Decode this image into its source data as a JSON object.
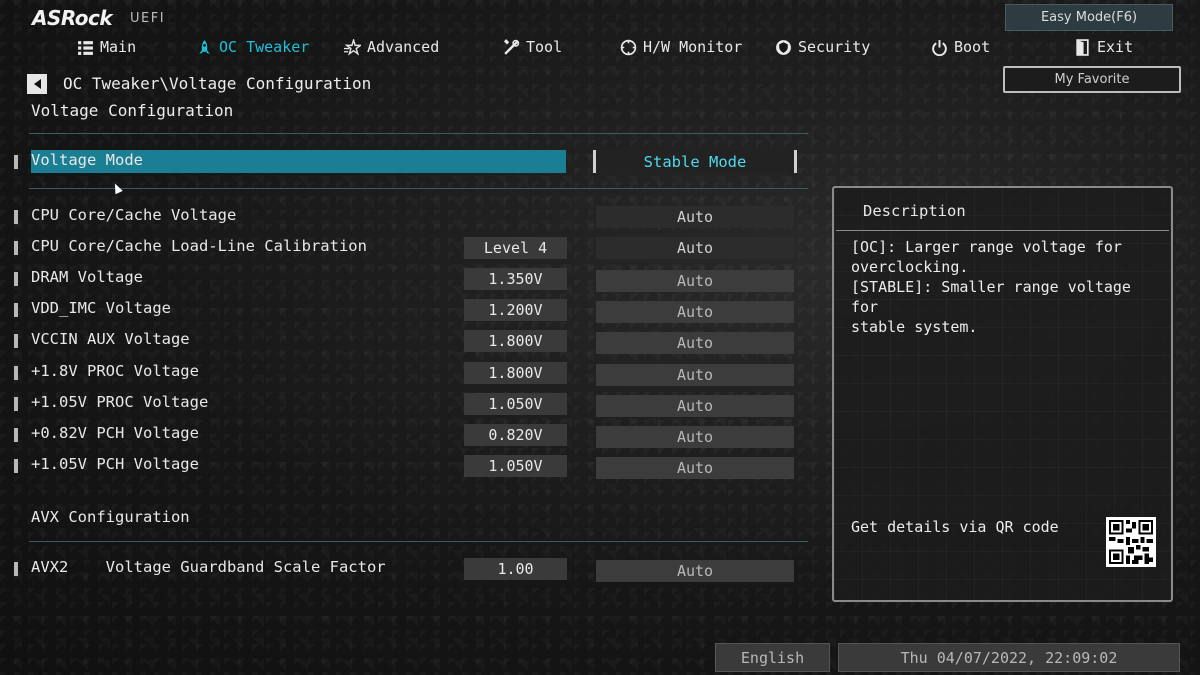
{
  "brand": {
    "logo": "ASRock",
    "sub": "UEFI"
  },
  "header": {
    "easy_mode": "Easy Mode(F6)",
    "my_favorite": "My Favorite"
  },
  "nav": [
    {
      "label": "Main",
      "icon": "main-list-icon",
      "active": false
    },
    {
      "label": "OC Tweaker",
      "icon": "rocket-icon",
      "active": true
    },
    {
      "label": "Advanced",
      "icon": "advanced-star-icon",
      "active": false
    },
    {
      "label": "Tool",
      "icon": "tools-icon",
      "active": false
    },
    {
      "label": "H/W Monitor",
      "icon": "monitor-gauge-icon",
      "active": false
    },
    {
      "label": "Security",
      "icon": "shield-icon",
      "active": false
    },
    {
      "label": "Boot",
      "icon": "power-icon",
      "active": false
    },
    {
      "label": "Exit",
      "icon": "exit-door-icon",
      "active": false
    }
  ],
  "breadcrumb": "OC Tweaker\\Voltage Configuration",
  "section_title": "Voltage Configuration",
  "voltage_mode": {
    "label": "Voltage Mode",
    "value": "Stable Mode"
  },
  "rows": [
    {
      "label": "CPU Core/Cache Voltage",
      "value": "",
      "option": "Auto"
    },
    {
      "label": "CPU Core/Cache Load-Line Calibration",
      "value": "Level 4",
      "option": "Auto"
    },
    {
      "label": "DRAM Voltage",
      "value": "1.350V",
      "option": "Auto"
    },
    {
      "label": "VDD_IMC Voltage",
      "value": "1.200V",
      "option": "Auto"
    },
    {
      "label": "VCCIN AUX Voltage",
      "value": "1.800V",
      "option": "Auto"
    },
    {
      "label": "+1.8V PROC Voltage",
      "value": "1.800V",
      "option": "Auto"
    },
    {
      "label": "+1.05V PROC Voltage",
      "value": "1.050V",
      "option": "Auto"
    },
    {
      "label": "+0.82V PCH Voltage",
      "value": "0.820V",
      "option": "Auto"
    },
    {
      "label": "+1.05V PCH Voltage",
      "value": "1.050V",
      "option": "Auto"
    }
  ],
  "avx": {
    "title": "AVX Configuration",
    "row": {
      "label": "AVX2    Voltage Guardband Scale Factor",
      "value": "1.00",
      "option": "Auto"
    }
  },
  "description": {
    "title": "Description",
    "text": "[OC]: Larger range voltage for\noverclocking.\n[STABLE]: Smaller range voltage for\nstable system.",
    "qr_text": "Get details via QR code"
  },
  "footer": {
    "language": "English",
    "datetime": "Thu 04/07/2022, 22:09:02"
  },
  "colors": {
    "accent": "#1ec0d8",
    "highlight": "#1b7f93"
  }
}
